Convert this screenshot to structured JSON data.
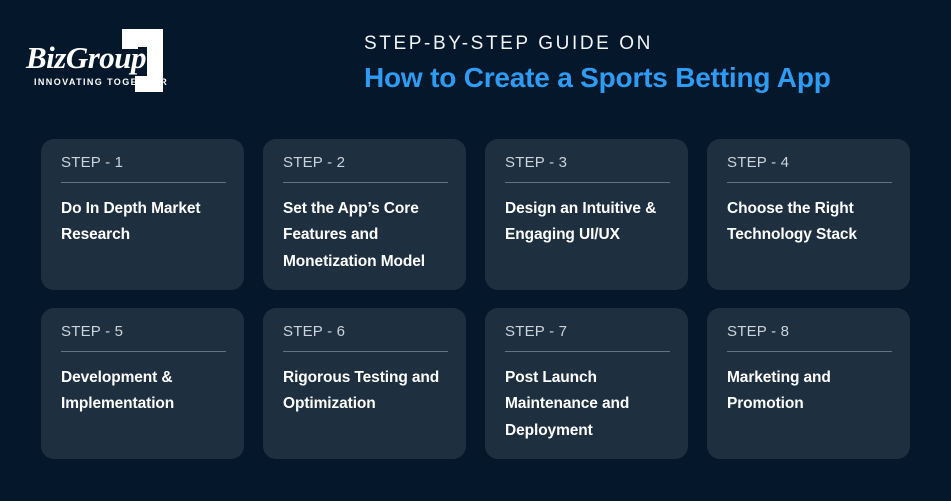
{
  "brand": {
    "name": "BizGroup",
    "tagline": "INNOVATING TOGETHER",
    "mark": "angular-bracket-mark"
  },
  "header": {
    "eyebrow": "STEP-BY-STEP GUIDE ON",
    "headline": "How to Create a Sports Betting App"
  },
  "colors": {
    "background": "#05172a",
    "card": "#1e2f40",
    "accent": "#2e9bf5",
    "step_label": "#ccd3da",
    "rule": "#5f7585",
    "title": "#ffffff"
  },
  "steps": [
    {
      "label": "STEP - 1",
      "title": "Do In Depth Market Research"
    },
    {
      "label": "STEP - 2",
      "title": "Set the App’s Core Features and Monetization Model"
    },
    {
      "label": "STEP - 3",
      "title": "Design an Intuitive & Engaging UI/UX"
    },
    {
      "label": "STEP - 4",
      "title": "Choose the Right Technology Stack"
    },
    {
      "label": "STEP - 5",
      "title": "Development & Implementation"
    },
    {
      "label": "STEP - 6",
      "title": "Rigorous Testing and Optimization"
    },
    {
      "label": "STEP - 7",
      "title": "Post Launch Maintenance and Deployment"
    },
    {
      "label": "STEP - 8",
      "title": "Marketing and Promotion"
    }
  ]
}
